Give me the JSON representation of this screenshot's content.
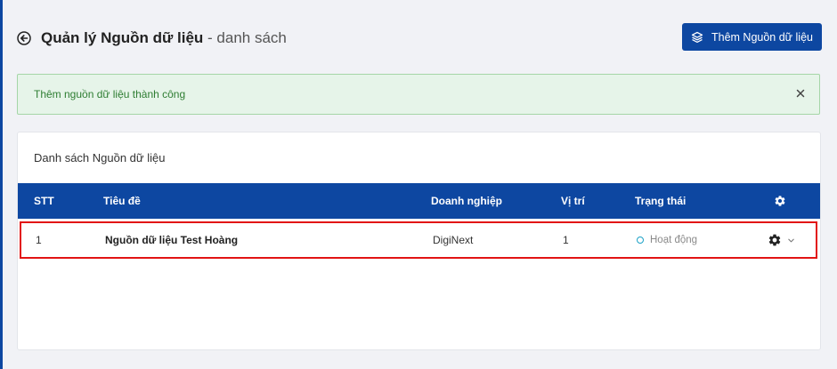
{
  "header": {
    "title_main": "Quản lý Nguồn dữ liệu",
    "title_separator": " - ",
    "title_sub": "danh sách",
    "add_button_label": "Thêm Nguồn dữ liệu"
  },
  "alert": {
    "message": "Thêm nguồn dữ liệu thành công",
    "close_symbol": "×"
  },
  "card": {
    "title": "Danh sách Nguồn dữ liệu"
  },
  "table": {
    "columns": [
      "STT",
      "Tiêu đề",
      "Doanh nghiệp",
      "Vị trí",
      "Trạng thái"
    ],
    "rows": [
      {
        "stt": "1",
        "title": "Nguồn dữ liệu Test Hoàng",
        "company": "DigiNext",
        "position": "1",
        "status": "Hoạt động"
      }
    ]
  },
  "colors": {
    "primary": "#0d47a1",
    "success_bg": "#e6f4e9",
    "success_border": "#a5d6a7",
    "success_text": "#2e7d32",
    "highlight_border": "#e21414",
    "status_dot": "#1ba1c6"
  },
  "icons": {
    "back": "arrow-left-circle-icon",
    "add": "layers-icon",
    "close": "close-icon",
    "settings": "gear-icon",
    "dropdown": "chevron-down-icon"
  }
}
